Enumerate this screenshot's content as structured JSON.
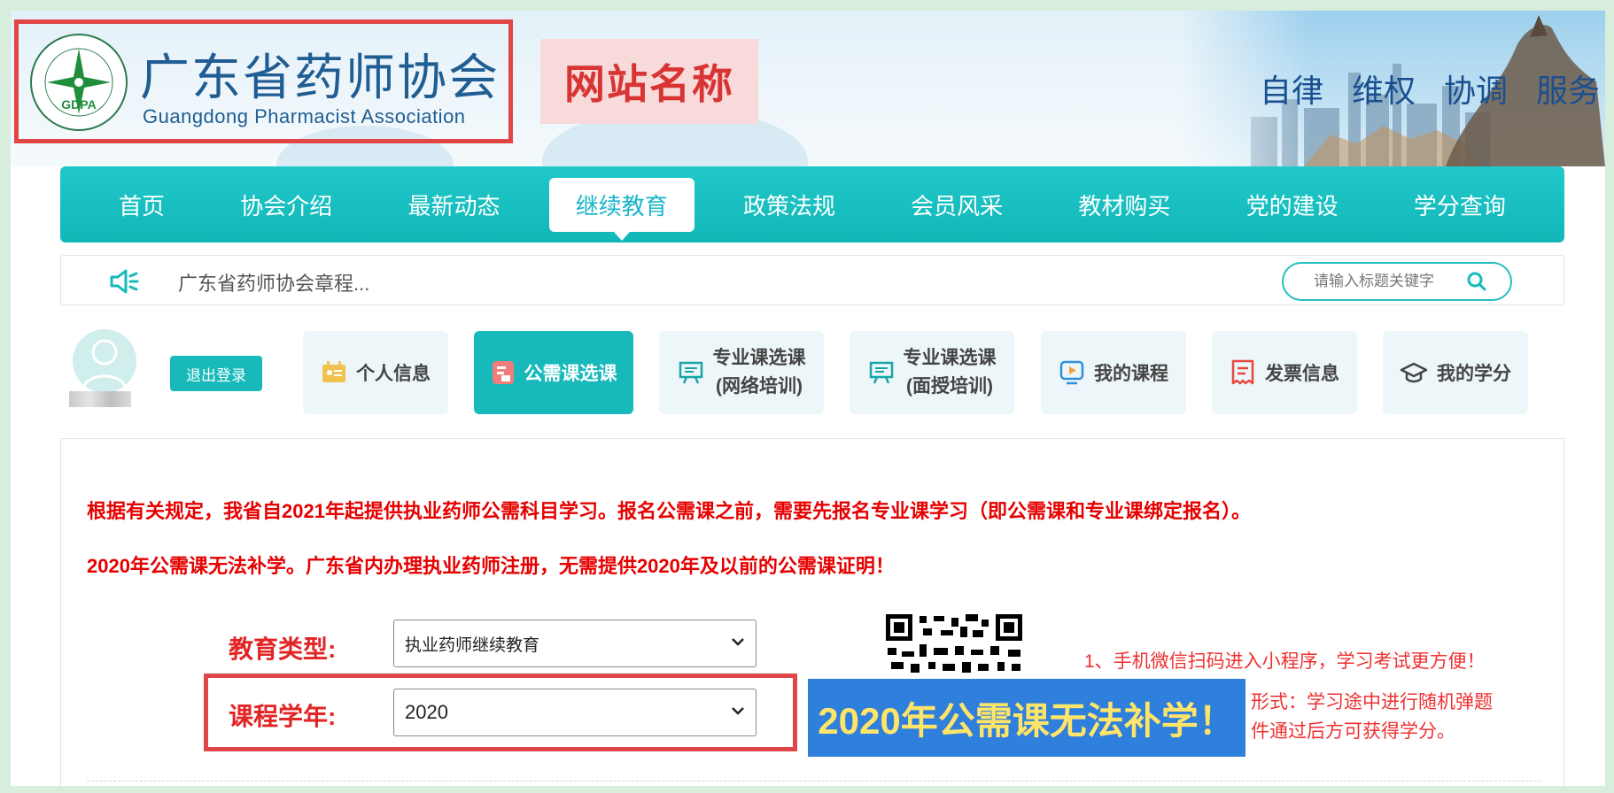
{
  "header": {
    "logo_seal_text": "GDPA",
    "logo_cn": "广东省药师协会",
    "logo_en": "Guangdong Pharmacist Association",
    "site_name_callout": "网站名称",
    "slogans": [
      "自律",
      "维权",
      "协调",
      "服务"
    ]
  },
  "nav": {
    "items": [
      "首页",
      "协会介绍",
      "最新动态",
      "继续教育",
      "政策法规",
      "会员风采",
      "教材购买",
      "党的建设",
      "学分查询"
    ],
    "active_index": 3
  },
  "notice": {
    "text": "广东省药师协会章程...",
    "search_placeholder": "请输入标题关键字"
  },
  "user": {
    "logout_label": "退出登录"
  },
  "tabs": [
    {
      "label": "个人信息",
      "icon": "id-card-icon"
    },
    {
      "label": "公需课选课",
      "icon": "document-icon",
      "active": true
    },
    {
      "label_line1": "专业课选课",
      "label_line2": "(网络培训)",
      "icon": "board-icon"
    },
    {
      "label_line1": "专业课选课",
      "label_line2": "(面授培训)",
      "icon": "board-icon"
    },
    {
      "label": "我的课程",
      "icon": "video-icon"
    },
    {
      "label": "发票信息",
      "icon": "receipt-icon"
    },
    {
      "label": "我的学分",
      "icon": "graduation-cap-icon"
    }
  ],
  "content": {
    "rule_1": "根据有关规定，我省自2021年起提供执业药师公需科目学习。报名公需课之前，需要先报名专业课学习（即公需课和专业课绑定报名）。",
    "rule_2": "2020年公需课无法补学。广东省内办理执业药师注册，无需提供2020年及以前的公需课证明！",
    "education_type_label": "教育类型:",
    "education_type_value": "执业药师继续教育",
    "course_year_label": "课程学年:",
    "course_year_value": "2020",
    "tip_1": "1、手机微信扫码进入小程序，学习考试更方便！",
    "tip_2_visible": "形式：学习途中进行随机弹题",
    "tip_3_visible": "件通过后方可获得学分。",
    "callout": "2020年公需课无法补学！"
  },
  "colors": {
    "teal": "#17b9bb",
    "alert_red": "#e60000",
    "annotation_red": "#e04646",
    "callout_blue": "#2f7fdc",
    "callout_yellow": "#ffe46a",
    "logo_blue": "#1f5d92"
  }
}
